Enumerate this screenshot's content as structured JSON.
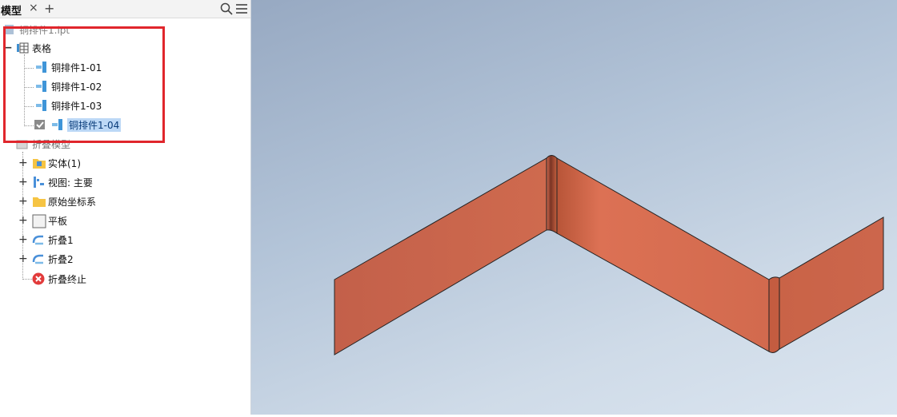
{
  "tab": {
    "title": "模型",
    "close": "×",
    "add": "+"
  },
  "tree": {
    "root": "铜排件1.ipt",
    "table": "表格",
    "rows": [
      "铜排件1-01",
      "铜排件1-02",
      "铜排件1-03",
      "铜排件1-04"
    ],
    "fold_model": "折叠模型",
    "items": [
      "实体(1)",
      "视图: 主要",
      "原始坐标系",
      "平板",
      "折叠1",
      "折叠2",
      "折叠终止"
    ]
  },
  "colors": {
    "highlight": "#e0262c",
    "part": "#d2664a",
    "selection": "#bcd8f6"
  }
}
